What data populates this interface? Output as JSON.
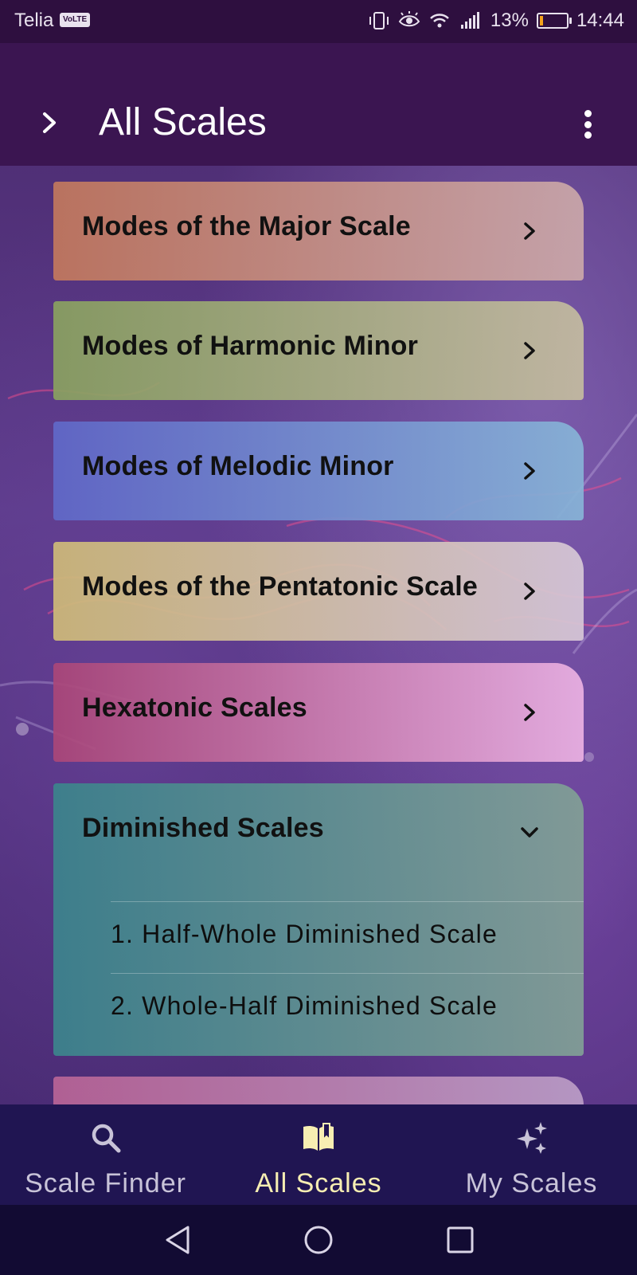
{
  "status_bar": {
    "carrier": "Telia",
    "network_badge": "VoLTE",
    "battery_percent": "13%",
    "battery_level": 0.13,
    "time": "14:44",
    "icons": [
      "vibrate-icon",
      "eye-comfort-icon",
      "wifi-icon",
      "signal-icon",
      "battery-icon"
    ]
  },
  "app_bar": {
    "title": "All Scales",
    "nav_icon": "chevron-right-icon",
    "menu_icon": "more-vertical-icon"
  },
  "categories": [
    {
      "label": "Modes of the Major Scale",
      "state": "collapsed"
    },
    {
      "label": "Modes of Harmonic Minor",
      "state": "collapsed"
    },
    {
      "label": "Modes of Melodic Minor",
      "state": "collapsed"
    },
    {
      "label": "Modes of the Pentatonic Scale",
      "state": "collapsed"
    },
    {
      "label": "Hexatonic Scales",
      "state": "collapsed"
    },
    {
      "label": "Diminished Scales",
      "state": "expanded",
      "items": [
        "1. Half-Whole Diminished Scale",
        "2. Whole-Half Diminished Scale"
      ]
    },
    {
      "label": "",
      "state": "collapsed"
    }
  ],
  "bottom_nav": {
    "items": [
      {
        "label": "Scale Finder",
        "icon": "search-icon",
        "active": false
      },
      {
        "label": "All Scales",
        "icon": "book-icon",
        "active": true
      },
      {
        "label": "My Scales",
        "icon": "sparkles-icon",
        "active": false
      }
    ],
    "active_color": "#f7eeb2",
    "inactive_color": "#c8c3d8"
  },
  "system_nav": {
    "buttons": [
      "back-icon",
      "home-icon",
      "recents-icon"
    ]
  }
}
